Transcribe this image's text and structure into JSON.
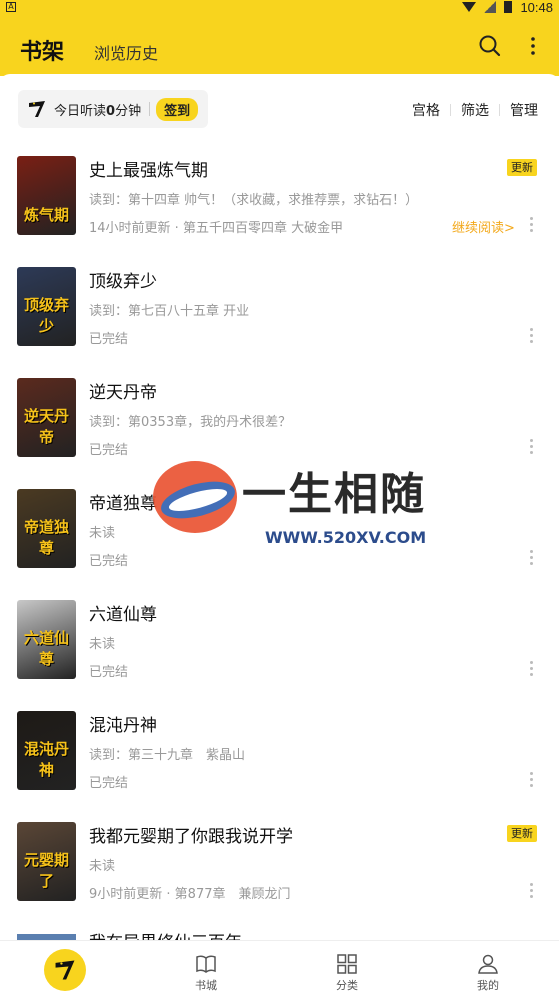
{
  "status_bar": {
    "time": "10:48"
  },
  "header": {
    "title": "书架",
    "history_tab": "浏览历史"
  },
  "listen_card": {
    "prefix": "今日听读",
    "minutes": "0",
    "suffix": "分钟",
    "sign_label": "签到"
  },
  "toolbar": {
    "grid": "宫格",
    "filter": "筛选",
    "manage": "管理"
  },
  "books": [
    {
      "title": "史上最强炼气期",
      "reading": "读到：第十四章 帅气！（求收藏，求推荐票，求钻石！）",
      "status": "14小时前更新 · 第五千四百零四章 大破金甲",
      "badge": "更新",
      "continue": "继续阅读>",
      "cover_text": "炼气期",
      "cover_color": "#7a1f14"
    },
    {
      "title": "顶级弃少",
      "reading": "读到：第七百八十五章 开业",
      "status": "已完结",
      "badge": "",
      "continue": "",
      "cover_text": "顶级弃少",
      "cover_color": "#2d3a57"
    },
    {
      "title": "逆天丹帝",
      "reading": "读到：第0353章，我的丹术很差？",
      "status": "已完结",
      "badge": "",
      "continue": "",
      "cover_text": "逆天丹帝",
      "cover_color": "#5b2a1e"
    },
    {
      "title": "帝道独尊",
      "reading": "未读",
      "status": "已完结",
      "badge": "",
      "continue": "",
      "cover_text": "帝道独尊",
      "cover_color": "#4b3a22"
    },
    {
      "title": "六道仙尊",
      "reading": "未读",
      "status": "已完结",
      "badge": "",
      "continue": "",
      "cover_text": "六道仙尊",
      "cover_color": "#c8c8c8"
    },
    {
      "title": "混沌丹神",
      "reading": "读到：第三十九章　紫晶山",
      "status": "已完结",
      "badge": "",
      "continue": "",
      "cover_text": "混沌丹神",
      "cover_color": "#1e1a16"
    },
    {
      "title": "我都元婴期了你跟我说开学",
      "reading": "未读",
      "status": "9小时前更新 · 第877章　兼顾龙门",
      "badge": "更新",
      "continue": "",
      "cover_text": "元婴期了",
      "cover_color": "#5a4636"
    }
  ],
  "partial_book": {
    "title": "我在异界修仙三百年"
  },
  "watermark": {
    "text": "一生相随",
    "url": "WWW.520XV.COM"
  },
  "tabs": [
    {
      "label": "",
      "icon": "app-logo-icon"
    },
    {
      "label": "书城",
      "icon": "book-icon"
    },
    {
      "label": "分类",
      "icon": "grid-icon"
    },
    {
      "label": "我的",
      "icon": "user-icon"
    }
  ]
}
